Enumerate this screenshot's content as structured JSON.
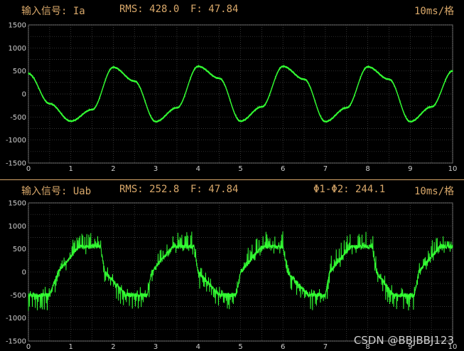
{
  "panel1": {
    "label": "输入信号: Ia",
    "rms": "RMS: 428.0",
    "freq": "F: 47.84",
    "timebase": "10ms/格"
  },
  "panel2": {
    "label": "输入信号: Uab",
    "rms": "RMS: 252.8",
    "freq": "F: 47.84",
    "phase": "Φ1-Φ2: 244.1",
    "timebase": "10ms/格"
  },
  "watermark": "CSDN @BBJBBJ123",
  "colors": {
    "trace": "#33ff33",
    "header": "#d9a86a",
    "grid": "#4a4a4a"
  },
  "chart_data": [
    {
      "type": "line",
      "title": "",
      "x_ticks": [
        0,
        1,
        2,
        3,
        4,
        5,
        6,
        7,
        8,
        9,
        10
      ],
      "y_ticks": [
        1500,
        1000,
        500,
        0,
        -500,
        -1000,
        -1500
      ],
      "xlim": [
        0,
        10
      ],
      "ylim": [
        -1500,
        1500
      ],
      "grid": true,
      "series": [
        {
          "x": [
            0,
            0.5,
            1,
            1.5,
            2,
            2.5,
            3,
            3.5,
            4,
            4.5,
            5,
            5.5,
            6,
            6.5,
            7,
            7.5,
            8,
            8.5,
            9,
            9.5,
            10
          ],
          "y": [
            440,
            -210,
            -590,
            -340,
            580,
            280,
            -600,
            -300,
            600,
            340,
            -590,
            -280,
            600,
            320,
            -600,
            -300,
            590,
            320,
            -600,
            -280,
            500
          ]
        }
      ]
    },
    {
      "type": "line",
      "title": "",
      "x_ticks": [
        0,
        1,
        2,
        3,
        4,
        5,
        6,
        7,
        8,
        9,
        10
      ],
      "y_ticks": [
        1500,
        1000,
        500,
        0,
        -500,
        -1000,
        -1500
      ],
      "xlim": [
        0,
        10
      ],
      "ylim": [
        -1500,
        1500
      ],
      "grid": true,
      "series": [
        {
          "x": [
            0,
            0.5,
            0.7,
            1.2,
            1.7,
            1.8,
            2.3,
            2.8,
            2.9,
            3.4,
            3.9,
            4.0,
            4.5,
            4.9,
            5.0,
            5.5,
            6.0,
            6.1,
            6.6,
            7.0,
            7.1,
            7.6,
            8.1,
            8.2,
            8.6,
            9.1,
            9.2,
            9.7,
            10
          ],
          "y": [
            -500,
            -500,
            0,
            550,
            550,
            0,
            -500,
            -500,
            0,
            550,
            550,
            0,
            -500,
            -500,
            0,
            550,
            550,
            0,
            -500,
            -500,
            0,
            550,
            550,
            0,
            -500,
            -500,
            0,
            550,
            550
          ]
        }
      ]
    }
  ]
}
